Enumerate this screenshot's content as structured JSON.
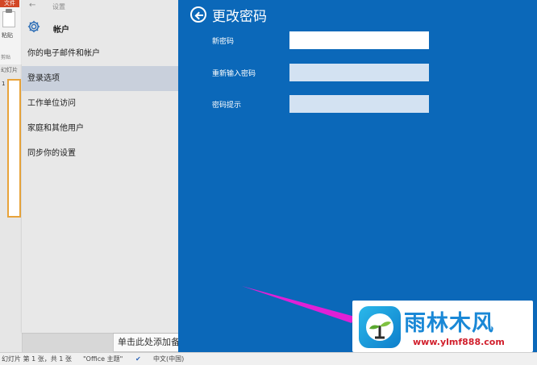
{
  "ppt": {
    "file_tab": "文件",
    "paste_label": "粘贴",
    "clipboard_label": "剪贴",
    "slides_label": "幻灯片",
    "slide_number": "1",
    "notes_placeholder": "单击此处添加备注",
    "status": {
      "slide_info": "幻灯片 第 1 张，共 1 张",
      "theme": "\"Office 主题\"",
      "language": "中文(中国)"
    }
  },
  "settings": {
    "breadcrumb": "设置",
    "title": "帐户",
    "nav": [
      {
        "label": "你的电子邮件和帐户"
      },
      {
        "label": "登录选项"
      },
      {
        "label": "工作单位访问"
      },
      {
        "label": "家庭和其他用户"
      },
      {
        "label": "同步你的设置"
      }
    ],
    "selected_index": 1
  },
  "panel": {
    "title": "更改密码",
    "fields": [
      {
        "label": "新密码",
        "value": ""
      },
      {
        "label": "重新输入密码",
        "value": ""
      },
      {
        "label": "密码提示",
        "value": ""
      }
    ],
    "bg_color": "#0b68b9"
  },
  "annotation": {
    "arrow_color": "#e020d6"
  },
  "watermark": {
    "title": "雨林木风",
    "url": "www.ylmf888.com"
  }
}
